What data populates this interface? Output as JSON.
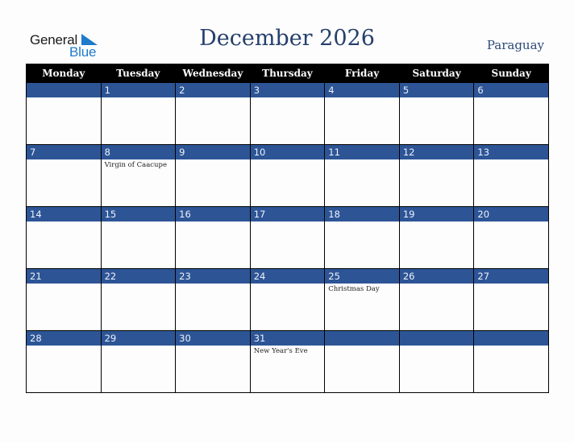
{
  "logo": {
    "word1": "General",
    "word2": "Blue"
  },
  "header": {
    "title": "December 2026",
    "country": "Paraguay"
  },
  "colors": {
    "accent": "#2d5596",
    "title": "#243f6b",
    "header_bg": "#000000",
    "logo_blue": "#1f7ac9"
  },
  "weekdays": [
    "Monday",
    "Tuesday",
    "Wednesday",
    "Thursday",
    "Friday",
    "Saturday",
    "Sunday"
  ],
  "weeks": [
    [
      {
        "day": "",
        "holiday": ""
      },
      {
        "day": "1",
        "holiday": ""
      },
      {
        "day": "2",
        "holiday": ""
      },
      {
        "day": "3",
        "holiday": ""
      },
      {
        "day": "4",
        "holiday": ""
      },
      {
        "day": "5",
        "holiday": ""
      },
      {
        "day": "6",
        "holiday": ""
      }
    ],
    [
      {
        "day": "7",
        "holiday": ""
      },
      {
        "day": "8",
        "holiday": "Virgin of Caacupe"
      },
      {
        "day": "9",
        "holiday": ""
      },
      {
        "day": "10",
        "holiday": ""
      },
      {
        "day": "11",
        "holiday": ""
      },
      {
        "day": "12",
        "holiday": ""
      },
      {
        "day": "13",
        "holiday": ""
      }
    ],
    [
      {
        "day": "14",
        "holiday": ""
      },
      {
        "day": "15",
        "holiday": ""
      },
      {
        "day": "16",
        "holiday": ""
      },
      {
        "day": "17",
        "holiday": ""
      },
      {
        "day": "18",
        "holiday": ""
      },
      {
        "day": "19",
        "holiday": ""
      },
      {
        "day": "20",
        "holiday": ""
      }
    ],
    [
      {
        "day": "21",
        "holiday": ""
      },
      {
        "day": "22",
        "holiday": ""
      },
      {
        "day": "23",
        "holiday": ""
      },
      {
        "day": "24",
        "holiday": ""
      },
      {
        "day": "25",
        "holiday": "Christmas Day"
      },
      {
        "day": "26",
        "holiday": ""
      },
      {
        "day": "27",
        "holiday": ""
      }
    ],
    [
      {
        "day": "28",
        "holiday": ""
      },
      {
        "day": "29",
        "holiday": ""
      },
      {
        "day": "30",
        "holiday": ""
      },
      {
        "day": "31",
        "holiday": "New Year's Eve"
      },
      {
        "day": "",
        "holiday": ""
      },
      {
        "day": "",
        "holiday": ""
      },
      {
        "day": "",
        "holiday": ""
      }
    ]
  ]
}
